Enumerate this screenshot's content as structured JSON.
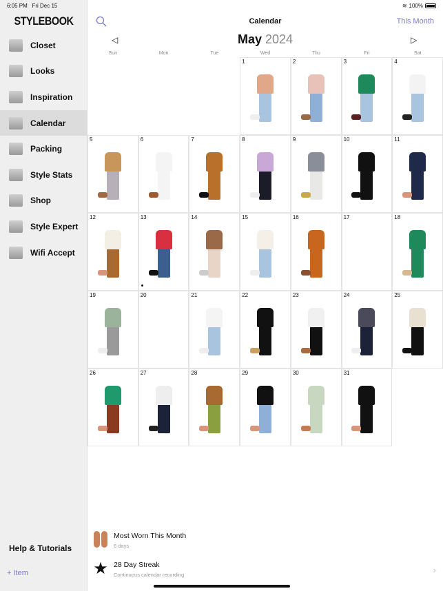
{
  "status": {
    "time": "6:05 PM",
    "date": "Fri Dec 15",
    "battery": "100%",
    "battery_level": 1.0
  },
  "sidebar": {
    "logo": "STYLEBOOK",
    "items": [
      {
        "label": "Closet",
        "icon": "hanger-icon"
      },
      {
        "label": "Looks",
        "icon": "looks-icon"
      },
      {
        "label": "Inspiration",
        "icon": "inspiration-icon"
      },
      {
        "label": "Calendar",
        "icon": "calendar-icon",
        "selected": true
      },
      {
        "label": "Packing",
        "icon": "suitcase-icon"
      },
      {
        "label": "Style Stats",
        "icon": "stats-icon"
      },
      {
        "label": "Shop",
        "icon": "shopping-bag-icon"
      },
      {
        "label": "Style Expert",
        "icon": "book-icon"
      },
      {
        "label": "Wifi Accept",
        "icon": "envelope-icon"
      }
    ],
    "help": "Help & Tutorials",
    "add_item": "+ Item"
  },
  "header": {
    "title": "Calendar",
    "this_month": "This Month",
    "month": "May",
    "year": "2024",
    "prev": "◁",
    "next": "▷"
  },
  "weekdays": [
    "Sun",
    "Mon",
    "Tue",
    "Wed",
    "Thu",
    "Fri",
    "Sat"
  ],
  "first_weekday_index": 3,
  "days": [
    {
      "d": "1",
      "c": [
        "#e0a888",
        "#a9c4de",
        "#eeeeee"
      ]
    },
    {
      "d": "2",
      "c": [
        "#e8c2b8",
        "#8fb0d6",
        "#9a6a45"
      ]
    },
    {
      "d": "3",
      "c": [
        "#1e8a5c",
        "#a9c4de",
        "#5a1f1f"
      ]
    },
    {
      "d": "4",
      "c": [
        "#f3f3f3",
        "#a9c4de",
        "#222222"
      ]
    },
    {
      "d": "5",
      "c": [
        "#c8965a",
        "#b8b0b8",
        "#a06a45"
      ]
    },
    {
      "d": "6",
      "c": [
        "#f4f4f4",
        "#f4f4f4",
        "#a05a30"
      ]
    },
    {
      "d": "7",
      "c": [
        "#b8702a",
        "#b8702a",
        "#111111"
      ]
    },
    {
      "d": "8",
      "c": [
        "#c9a8d8",
        "#1c1c28",
        "#eeeeee"
      ]
    },
    {
      "d": "9",
      "c": [
        "#8a8e98",
        "#e8e8e6",
        "#c9a94a"
      ]
    },
    {
      "d": "10",
      "c": [
        "#111111",
        "#111111",
        "#111111"
      ]
    },
    {
      "d": "11",
      "c": [
        "#1f2a4a",
        "#1f2a4a",
        "#d8957a"
      ]
    },
    {
      "d": "12",
      "c": [
        "#f4efe4",
        "#a86a30",
        "#d8957a"
      ]
    },
    {
      "d": "13",
      "c": [
        "#d83040",
        "#3b5f8f",
        "#111111"
      ],
      "dot": true
    },
    {
      "d": "14",
      "c": [
        "#9a6a48",
        "#e8d5c8",
        "#cccccc"
      ]
    },
    {
      "d": "15",
      "c": [
        "#f4f0e8",
        "#a9c4de",
        "#eeeeee"
      ]
    },
    {
      "d": "16",
      "c": [
        "#c8661e",
        "#c8661e",
        "#8a5030"
      ]
    },
    {
      "d": "17",
      "c": null
    },
    {
      "d": "18",
      "c": [
        "#1e8a5c",
        "#1e8a5c",
        "#d8b890"
      ]
    },
    {
      "d": "19",
      "c": [
        "#9ab39a",
        "#9a9a9a",
        "#eeeeee"
      ]
    },
    {
      "d": "20",
      "c": null
    },
    {
      "d": "21",
      "c": [
        "#f4f4f4",
        "#a9c4de",
        "#eeeeee"
      ]
    },
    {
      "d": "22",
      "c": [
        "#111111",
        "#111111",
        "#c9a060"
      ]
    },
    {
      "d": "23",
      "c": [
        "#f0f0f0",
        "#111111",
        "#a86a40"
      ]
    },
    {
      "d": "24",
      "c": [
        "#4a4a5a",
        "#1c2338",
        "#eeeeee"
      ]
    },
    {
      "d": "25",
      "c": [
        "#e8e0d0",
        "#111111",
        "#111111"
      ]
    },
    {
      "d": "26",
      "c": [
        "#1e9a6c",
        "#8a3a20",
        "#d8957a"
      ]
    },
    {
      "d": "27",
      "c": [
        "#eeeeee",
        "#1c2338",
        "#222222"
      ]
    },
    {
      "d": "28",
      "c": [
        "#a86a30",
        "#8aa040",
        "#d8957a"
      ]
    },
    {
      "d": "29",
      "c": [
        "#111111",
        "#8fb0d6",
        "#d8957a"
      ]
    },
    {
      "d": "30",
      "c": [
        "#c8d8c0",
        "#c8d8c0",
        "#c87a50"
      ]
    },
    {
      "d": "31",
      "c": [
        "#111111",
        "#111111",
        "#d8957a"
      ]
    }
  ],
  "stats": [
    {
      "title": "Most Worn This Month",
      "sub": "6 days",
      "icon": "sandals-icon"
    },
    {
      "title": "28 Day Streak",
      "sub": "Continuous calendar recording",
      "icon": "star-icon"
    }
  ],
  "accent": "#7a7acc"
}
